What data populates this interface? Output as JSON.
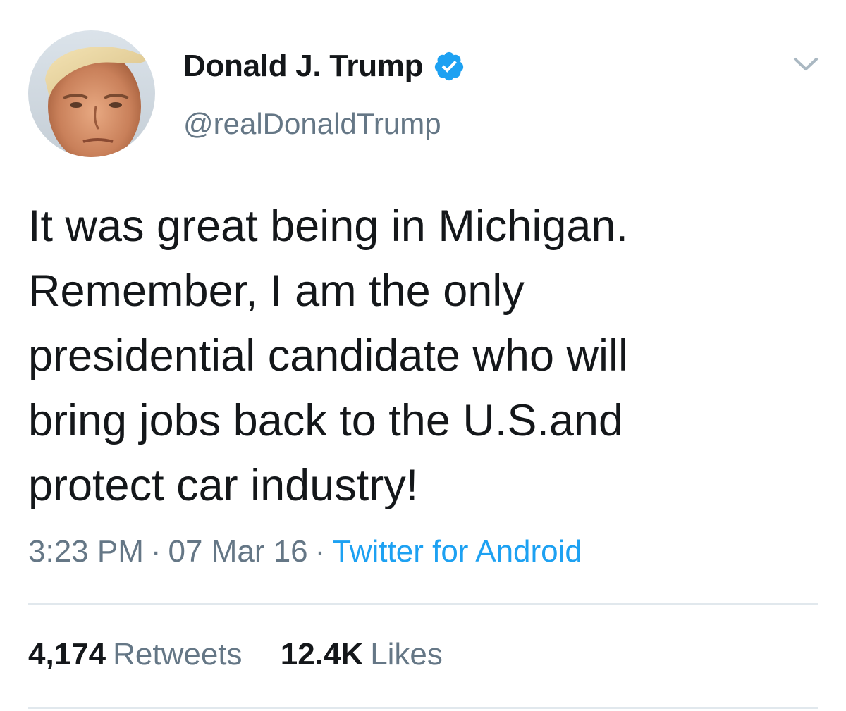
{
  "author": {
    "display_name": "Donald J. Trump",
    "handle": "@realDonaldTrump",
    "verified": true,
    "avatar_icon": "profile-photo"
  },
  "tweet": {
    "text": "It was great being in Michigan.\nRemember, I am the only\npresidential candidate who will\nbring jobs back to the U.S.and\nprotect car industry!",
    "time": "3:23 PM",
    "date": "07 Mar 16",
    "separator": "·",
    "source": "Twitter for Android"
  },
  "stats": {
    "retweets_count": "4,174",
    "retweets_label": "Retweets",
    "likes_count": "12.4K",
    "likes_label": "Likes"
  },
  "icons": {
    "verified": "verified-badge-icon",
    "menu": "chevron-down-icon"
  },
  "colors": {
    "text": "#14171a",
    "secondary": "#657786",
    "link": "#1da1f2",
    "divider": "#e1e8ed",
    "verified": "#1da1f2"
  }
}
